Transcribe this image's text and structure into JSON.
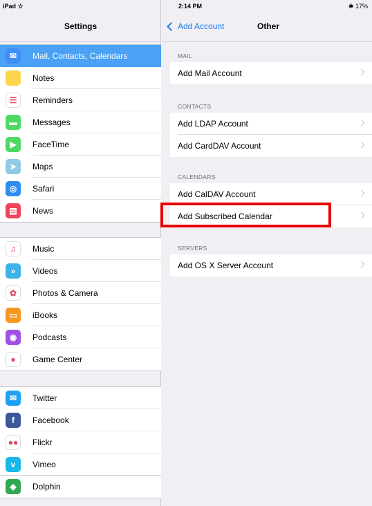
{
  "status": {
    "device": "iPad ☆",
    "time": "2:14 PM",
    "battery": "✱ 17%"
  },
  "left": {
    "title": "Settings",
    "groups": [
      [
        {
          "label": "Mail, Contacts, Calendars",
          "icon": "mail-icon",
          "color": "#3d8ff5",
          "glyph": "✉",
          "selected": true
        },
        {
          "label": "Notes",
          "icon": "notes-icon",
          "color": "#fcd54e",
          "glyph": ""
        },
        {
          "label": "Reminders",
          "icon": "reminders-icon",
          "color": "#ffffff",
          "glyph": "☰"
        },
        {
          "label": "Messages",
          "icon": "messages-icon",
          "color": "#4cd964",
          "glyph": "▬"
        },
        {
          "label": "FaceTime",
          "icon": "facetime-icon",
          "color": "#4cd964",
          "glyph": "▶"
        },
        {
          "label": "Maps",
          "icon": "maps-icon",
          "color": "#8fc9e6",
          "glyph": "➤"
        },
        {
          "label": "Safari",
          "icon": "safari-icon",
          "color": "#2f8cf0",
          "glyph": "◎"
        },
        {
          "label": "News",
          "icon": "news-icon",
          "color": "#f0445a",
          "glyph": "▤"
        }
      ],
      [
        {
          "label": "Music",
          "icon": "music-icon",
          "color": "#ffffff",
          "glyph": "♫"
        },
        {
          "label": "Videos",
          "icon": "videos-icon",
          "color": "#3db3e8",
          "glyph": "»"
        },
        {
          "label": "Photos & Camera",
          "icon": "photos-icon",
          "color": "#ffffff",
          "glyph": "✿"
        },
        {
          "label": "iBooks",
          "icon": "ibooks-icon",
          "color": "#f7971e",
          "glyph": "▭"
        },
        {
          "label": "Podcasts",
          "icon": "podcasts-icon",
          "color": "#a44fe3",
          "glyph": "◉"
        },
        {
          "label": "Game Center",
          "icon": "game-center-icon",
          "color": "#ffffff",
          "glyph": "●"
        }
      ],
      [
        {
          "label": "Twitter",
          "icon": "twitter-icon",
          "color": "#1ea1f2",
          "glyph": "✉"
        },
        {
          "label": "Facebook",
          "icon": "facebook-icon",
          "color": "#3b5998",
          "glyph": "f"
        },
        {
          "label": "Flickr",
          "icon": "flickr-icon",
          "color": "#ffffff",
          "glyph": "●●"
        },
        {
          "label": "Vimeo",
          "icon": "vimeo-icon",
          "color": "#1ab7ea",
          "glyph": "v"
        }
      ],
      [
        {
          "label": "Dolphin",
          "icon": "dolphin-icon",
          "color": "#2fa84f",
          "glyph": "◆"
        }
      ]
    ]
  },
  "right": {
    "back_label": "Add Account",
    "title": "Other",
    "sections": [
      {
        "header": "MAIL",
        "rows": [
          "Add Mail Account"
        ]
      },
      {
        "header": "CONTACTS",
        "rows": [
          "Add LDAP Account",
          "Add CardDAV Account"
        ]
      },
      {
        "header": "CALENDARS",
        "rows": [
          "Add CalDAV Account",
          "Add Subscribed Calendar"
        ]
      },
      {
        "header": "SERVERS",
        "rows": [
          "Add OS X Server Account"
        ]
      }
    ]
  }
}
